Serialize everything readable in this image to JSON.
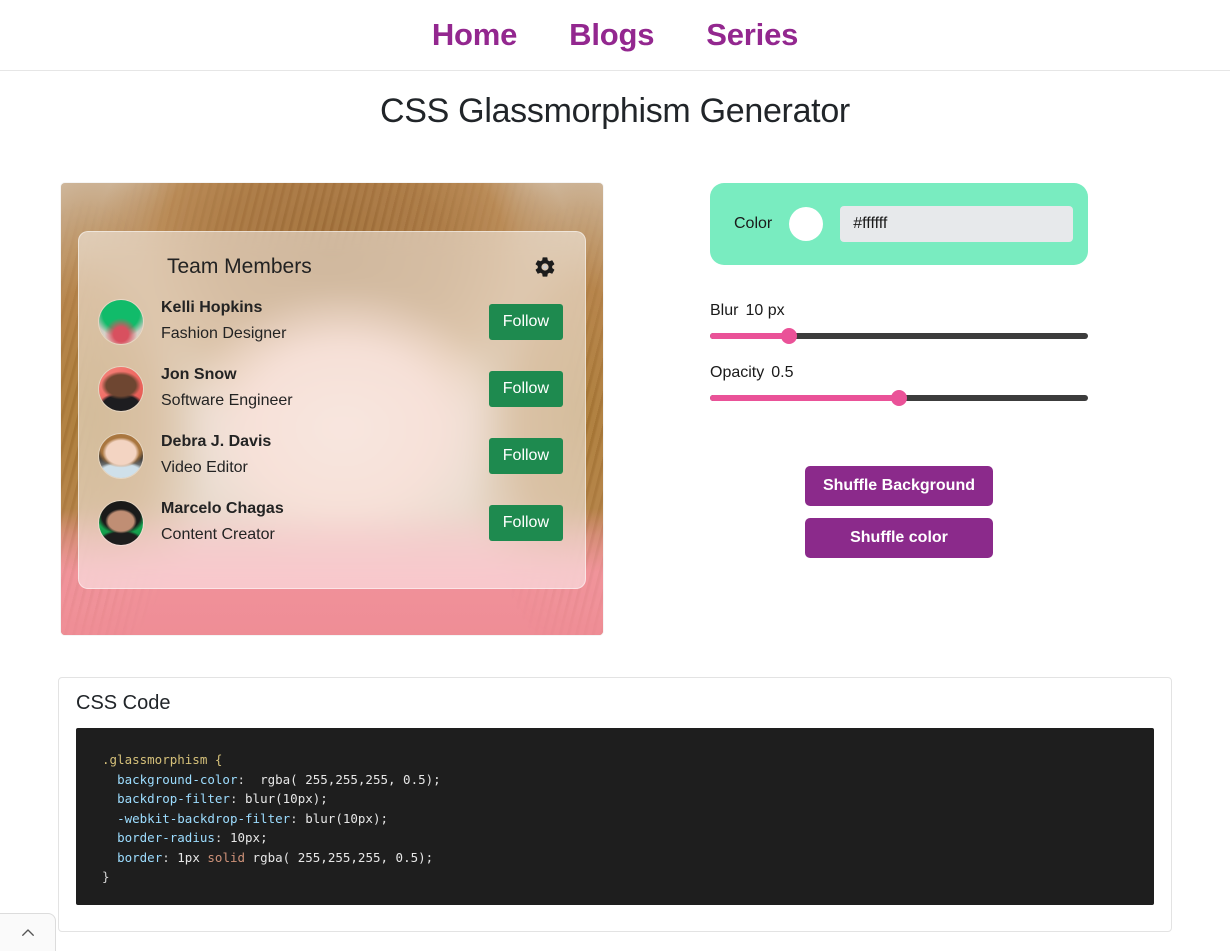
{
  "nav": {
    "links": [
      {
        "label": "Home"
      },
      {
        "label": "Blogs"
      },
      {
        "label": "Series"
      }
    ],
    "link_color": "#93278f"
  },
  "page": {
    "title": "CSS Glassmorphism Generator"
  },
  "preview": {
    "card": {
      "title": "Team Members",
      "settings_icon": "gear-icon",
      "members": [
        {
          "name": "Kelli Hopkins",
          "role": "Fashion Designer",
          "action": "Follow"
        },
        {
          "name": "Jon Snow",
          "role": "Software Engineer",
          "action": "Follow"
        },
        {
          "name": "Debra J. Davis",
          "role": "Video Editor",
          "action": "Follow"
        },
        {
          "name": "Marcelo Chagas",
          "role": "Content Creator",
          "action": "Follow"
        }
      ],
      "follow_color": "#1e8a4f",
      "glass_bg": "rgba(255,255,255,0.5)"
    }
  },
  "controls": {
    "color": {
      "label": "Color",
      "swatch_value": "#ffffff",
      "input_value": "#ffffff",
      "placeholder": "#ffffff",
      "panel_color": "#79ecc0"
    },
    "blur": {
      "label": "Blur",
      "value": "10 px",
      "percent": 21,
      "fill_color": "#ea5298",
      "track_color": "#3c3c3c"
    },
    "opacity": {
      "label": "Opacity",
      "value": "0.5",
      "percent": 50,
      "fill_color": "#ea5298",
      "track_color": "#3c3c3c"
    },
    "buttons": [
      {
        "label": "Shuffle Background"
      },
      {
        "label": "Shuffle color"
      }
    ],
    "button_color": "#8b2a8b"
  },
  "code_card": {
    "title": "CSS Code",
    "code_lines": [
      {
        "selector": ".glassmorphism {"
      },
      {
        "prop": "background-color",
        "sep": ":  ",
        "value": "rgba( 255,255,255, 0.5);"
      },
      {
        "prop": "backdrop-filter",
        "sep": ": ",
        "value": "blur(10px);"
      },
      {
        "prop": "-webkit-backdrop-filter",
        "sep": ": ",
        "value": "blur(10px);"
      },
      {
        "prop": "border-radius",
        "sep": ": ",
        "value": "10px;"
      },
      {
        "prop": "border",
        "sep": ": ",
        "value_pre": "1px ",
        "keyword": "solid",
        "value_post": " rgba( 255,255,255, 0.5);"
      },
      {
        "close": "}"
      }
    ],
    "code_text": ".glassmorphism {\n  background-color:  rgba( 255,255,255, 0.5);\n  backdrop-filter: blur(10px);\n  -webkit-backdrop-filter: blur(10px);\n  border-radius: 10px;\n  border: 1px solid rgba( 255,255,255, 0.5);\n}"
  },
  "scroll_top": {
    "icon": "chevron-up-icon"
  }
}
